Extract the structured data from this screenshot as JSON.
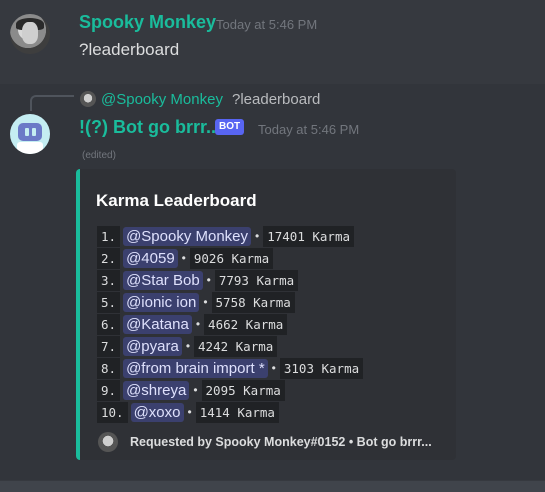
{
  "message_user": {
    "name": "Spooky Monkey",
    "timestamp": "Today at 5:46 PM",
    "text": "?leaderboard"
  },
  "message_bot": {
    "reply": {
      "name": "@Spooky Monkey",
      "text": "?leaderboard"
    },
    "name": "!(?) Bot go brrr...",
    "badge": "BOT",
    "timestamp": "Today at 5:46 PM",
    "edited": "(edited)",
    "embed": {
      "accent_color": "#1abc9c",
      "title": "Karma Leaderboard",
      "rows": [
        {
          "rank": "1.",
          "mention": "@Spooky Monkey",
          "karma": "17401 Karma"
        },
        {
          "rank": "2.",
          "mention": "@4059",
          "karma": "9026 Karma"
        },
        {
          "rank": "3.",
          "mention": "@Star Bob",
          "karma": "7793 Karma"
        },
        {
          "rank": "5.",
          "mention": "@ionic ion",
          "karma": "5758 Karma"
        },
        {
          "rank": "6.",
          "mention": "@Katana",
          "karma": "4662 Karma"
        },
        {
          "rank": "7.",
          "mention": "@pyara",
          "karma": "4242 Karma"
        },
        {
          "rank": "8.",
          "mention": "@from brain import *",
          "karma": "3103 Karma"
        },
        {
          "rank": "9.",
          "mention": "@shreya",
          "karma": "2095 Karma"
        },
        {
          "rank": "10.",
          "mention": "@xoxo",
          "karma": "1414 Karma"
        }
      ],
      "separator": "•",
      "footer": "Requested by Spooky Monkey#0152 • Bot go brrr..."
    }
  },
  "colors": {
    "username": "#1abc9c",
    "bot_badge": "#5865f2",
    "background": "#36393f",
    "mention_text": "#dee0fc"
  }
}
